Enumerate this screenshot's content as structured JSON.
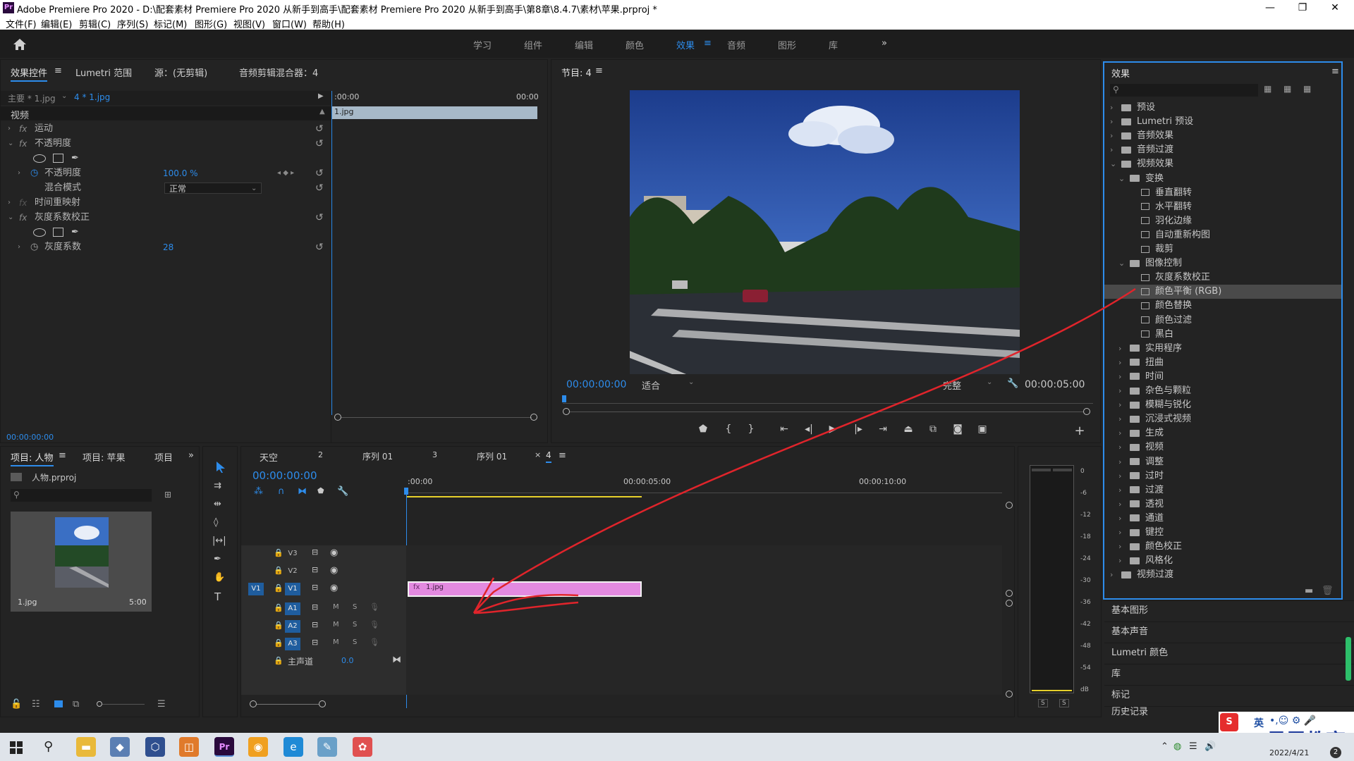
{
  "titlebar": {
    "logo": "Pr",
    "title": "Adobe Premiere Pro 2020 - D:\\配套素材 Premiere Pro 2020 从新手到高手\\配套素材 Premiere Pro 2020 从新手到高手\\第8章\\8.4.7\\素材\\苹果.prproj *",
    "minimize": "—",
    "maximize": "❐",
    "close": "✕"
  },
  "menu": [
    "文件(F)",
    "编辑(E)",
    "剪辑(C)",
    "序列(S)",
    "标记(M)",
    "图形(G)",
    "视图(V)",
    "窗口(W)",
    "帮助(H)"
  ],
  "workspaces": [
    "学习",
    "组件",
    "编辑",
    "颜色",
    "效果",
    "音频",
    "图形",
    "库"
  ],
  "workspace_active": "效果",
  "workspace_more": "»",
  "effect_controls": {
    "tabs": [
      "效果控件",
      "Lumetri 范围",
      "源：(无剪辑)",
      "音频剪辑混合器：4"
    ],
    "master_clip": "主要 * 1.jpg",
    "clip": "4 * 1.jpg",
    "section_video": "视频",
    "time_start": ":00:00",
    "time_end": "00:00",
    "clip_name": "1.jpg",
    "motion": "运动",
    "opacity": "不透明度",
    "opacity_label": "不透明度",
    "opacity_value": "100.0 %",
    "blend_mode": "混合模式",
    "blend_value": "正常",
    "time_remap": "时间重映射",
    "gamma": "灰度系数校正",
    "gamma_label": "灰度系数",
    "gamma_value": "28",
    "timecode": "00:00:00:00"
  },
  "program_monitor": {
    "title": "节目: 4",
    "timecode": "00:00:00:00",
    "fit": "适合",
    "quality": "完整",
    "duration": "00:00:05:00"
  },
  "project": {
    "tabs": [
      "项目: 人物",
      "项目: 苹果",
      "项目"
    ],
    "file": "人物.prproj",
    "search_placeholder": "",
    "clip_name": "1.jpg",
    "clip_duration": "5:00"
  },
  "timeline": {
    "tabs": [
      "天空",
      "2",
      "序列 01",
      "3",
      "序列 01",
      "4"
    ],
    "timecode": "00:00:00:00",
    "ruler": [
      ":00:00",
      "00:00:05:00",
      "00:00:10:00"
    ],
    "video_tracks": [
      "V3",
      "V2",
      "V1"
    ],
    "audio_tracks": [
      "A1",
      "A2",
      "A3"
    ],
    "source_patch": "V1",
    "master": "主声道",
    "master_value": "0.0",
    "clip": "1.jpg",
    "m": "M",
    "s": "S"
  },
  "meter": {
    "scale": [
      "0",
      "-6",
      "-12",
      "-18",
      "-24",
      "-30",
      "-36",
      "-42",
      "-48",
      "-54",
      "dB"
    ],
    "solo": [
      "S",
      "S"
    ]
  },
  "effects": {
    "title": "效果",
    "tree": [
      {
        "label": "预设",
        "level": 0,
        "type": "folder",
        "state": "closed"
      },
      {
        "label": "Lumetri 预设",
        "level": 0,
        "type": "folder",
        "state": "closed"
      },
      {
        "label": "音频效果",
        "level": 0,
        "type": "folder",
        "state": "closed"
      },
      {
        "label": "音频过渡",
        "level": 0,
        "type": "folder",
        "state": "closed"
      },
      {
        "label": "视频效果",
        "level": 0,
        "type": "folder",
        "state": "open"
      },
      {
        "label": "变换",
        "level": 1,
        "type": "folder",
        "state": "open"
      },
      {
        "label": "垂直翻转",
        "level": 2,
        "type": "effect"
      },
      {
        "label": "水平翻转",
        "level": 2,
        "type": "effect"
      },
      {
        "label": "羽化边缘",
        "level": 2,
        "type": "effect"
      },
      {
        "label": "自动重新构图",
        "level": 2,
        "type": "effect"
      },
      {
        "label": "裁剪",
        "level": 2,
        "type": "effect"
      },
      {
        "label": "图像控制",
        "level": 1,
        "type": "folder",
        "state": "open"
      },
      {
        "label": "灰度系数校正",
        "level": 2,
        "type": "effect"
      },
      {
        "label": "颜色平衡 (RGB)",
        "level": 2,
        "type": "effect",
        "selected": true
      },
      {
        "label": "颜色替换",
        "level": 2,
        "type": "effect"
      },
      {
        "label": "颜色过滤",
        "level": 2,
        "type": "effect"
      },
      {
        "label": "黑白",
        "level": 2,
        "type": "effect"
      },
      {
        "label": "实用程序",
        "level": 1,
        "type": "folder",
        "state": "closed"
      },
      {
        "label": "扭曲",
        "level": 1,
        "type": "folder",
        "state": "closed"
      },
      {
        "label": "时间",
        "level": 1,
        "type": "folder",
        "state": "closed"
      },
      {
        "label": "杂色与颗粒",
        "level": 1,
        "type": "folder",
        "state": "closed"
      },
      {
        "label": "模糊与锐化",
        "level": 1,
        "type": "folder",
        "state": "closed"
      },
      {
        "label": "沉浸式视频",
        "level": 1,
        "type": "folder",
        "state": "closed"
      },
      {
        "label": "生成",
        "level": 1,
        "type": "folder",
        "state": "closed"
      },
      {
        "label": "视频",
        "level": 1,
        "type": "folder",
        "state": "closed"
      },
      {
        "label": "调整",
        "level": 1,
        "type": "folder",
        "state": "closed"
      },
      {
        "label": "过时",
        "level": 1,
        "type": "folder",
        "state": "closed"
      },
      {
        "label": "过渡",
        "level": 1,
        "type": "folder",
        "state": "closed"
      },
      {
        "label": "透视",
        "level": 1,
        "type": "folder",
        "state": "closed"
      },
      {
        "label": "通道",
        "level": 1,
        "type": "folder",
        "state": "closed"
      },
      {
        "label": "键控",
        "level": 1,
        "type": "folder",
        "state": "closed"
      },
      {
        "label": "颜色校正",
        "level": 1,
        "type": "folder",
        "state": "closed"
      },
      {
        "label": "风格化",
        "level": 1,
        "type": "folder",
        "state": "closed"
      },
      {
        "label": "视频过渡",
        "level": 0,
        "type": "folder",
        "state": "closed"
      }
    ],
    "side_panels": [
      "基本图形",
      "基本声音",
      "Lumetri 颜色",
      "库",
      "标记",
      "历史记录"
    ]
  },
  "watermark": {
    "text": "最需教育",
    "ime": "英"
  },
  "taskbar": {
    "date": "2022/4/21",
    "badge": "2"
  },
  "colors": {
    "accent": "#2d8ceb",
    "clip_pink": "#e38ae0",
    "annotation_red": "#e0242b"
  }
}
